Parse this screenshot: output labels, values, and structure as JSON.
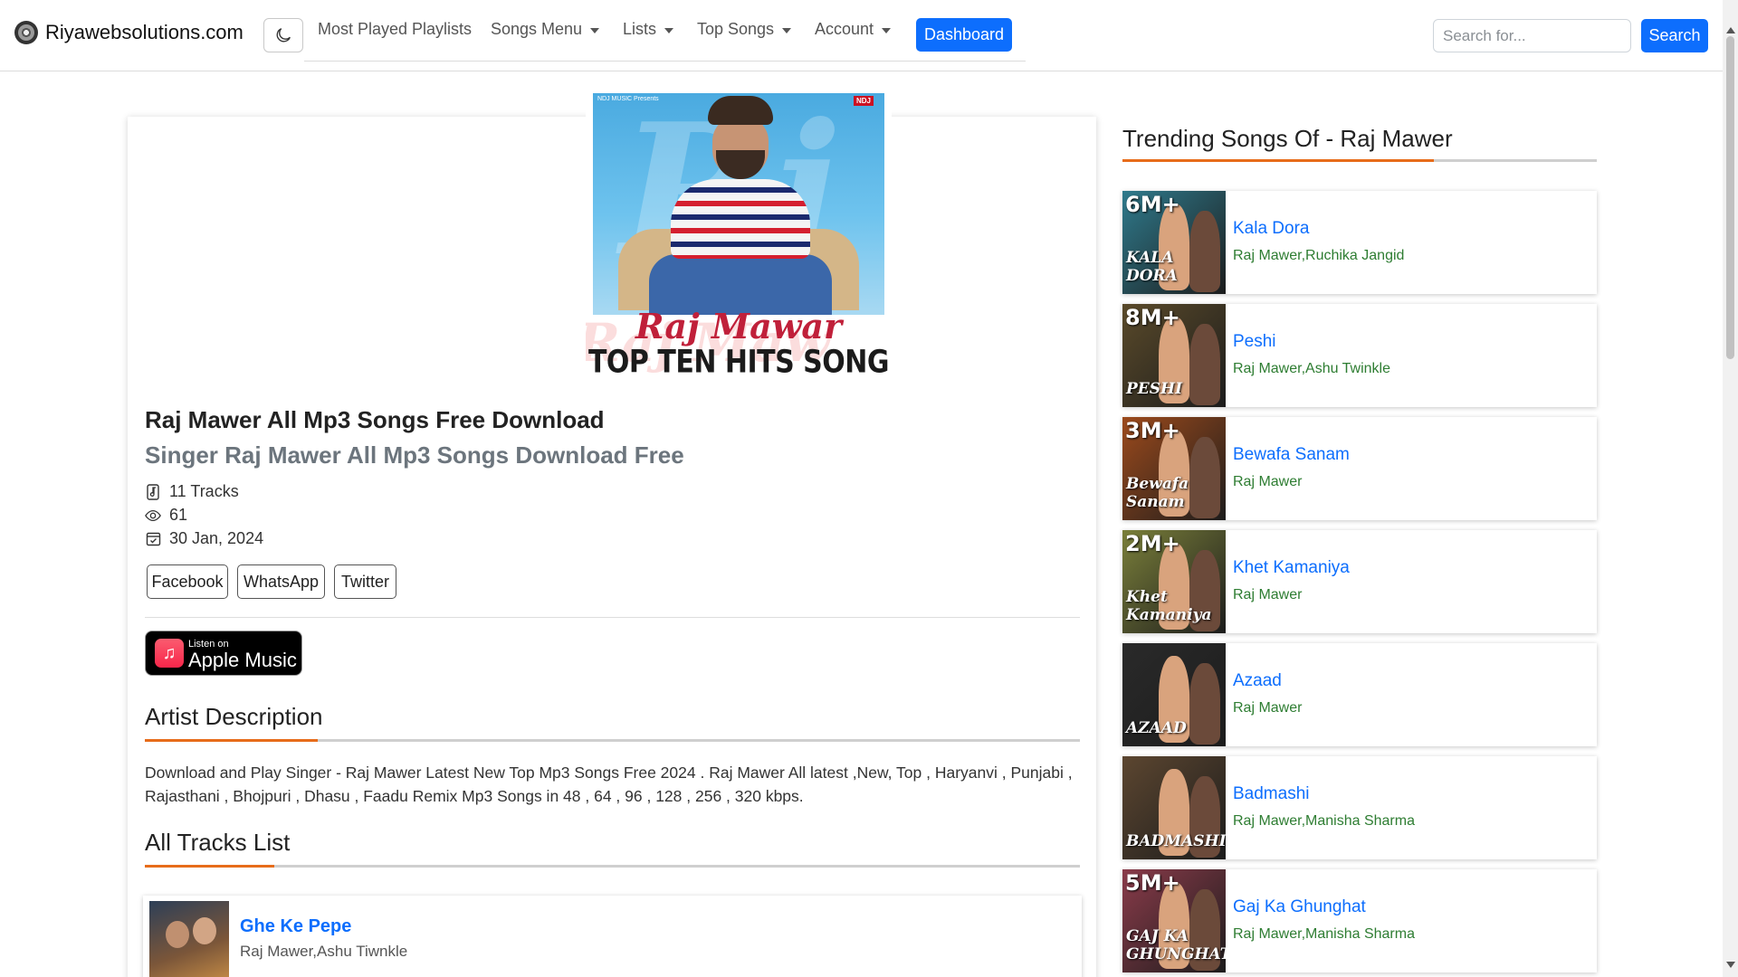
{
  "header": {
    "brand": "Riyawebsolutions.com",
    "nav": [
      "Most Played Playlists",
      "Songs Menu",
      "Lists",
      "Top Songs",
      "Account"
    ],
    "dashboard": "Dashboard",
    "search_placeholder": "Search for...",
    "search_button": "Search"
  },
  "cover": {
    "brand_text": "NDJ MUSIC Presents",
    "tag": "NDJ",
    "title1": "Raj Mawar",
    "title2": "TOP TEN HITS SONG"
  },
  "artist": {
    "title": "Raj Mawer All Mp3 Songs Free Download",
    "subtitle": "Singer Raj Mawer All Mp3 Songs Download Free",
    "tracks": "11 Tracks",
    "views": "61",
    "date": "30 Jan, 2024"
  },
  "share": [
    "Facebook",
    "WhatsApp",
    "Twitter"
  ],
  "apple": {
    "small": "Listen on",
    "big": "Apple Music"
  },
  "description": {
    "heading": "Artist Description",
    "text": "Download and Play Singer - Raj Mawer Latest New Top Mp3 Songs Free 2024 . Raj Mawer All latest ,New, Top , Haryanvi , Punjabi , Rajasthani , Bhojpuri , Dhasu , Faadu Remix Mp3 Songs in 48 , 64 , 96 , 128 , 256 , 320 kbps."
  },
  "tracks_list": {
    "heading": "All Tracks List",
    "items": [
      {
        "name": "Ghe Ke Pepe",
        "artist": "Raj Mawer,Ashu Tiwnkle"
      }
    ]
  },
  "trending": {
    "heading": "Trending Songs Of - Raj Mawer",
    "items": [
      {
        "name": "Kala Dora",
        "artist": "Raj Mawer,Ruchika Jangid",
        "views": "6M+",
        "thumb_title": "KALA DORA",
        "bg": "#2f7a8c"
      },
      {
        "name": "Peshi",
        "artist": "Raj Mawer,Ashu Twinkle",
        "views": "8M+",
        "thumb_title": "PESHI",
        "bg": "#5a4a2a"
      },
      {
        "name": "Bewafa Sanam",
        "artist": "Raj Mawer",
        "views": "3M+",
        "thumb_title": "Bewafa Sanam",
        "bg": "#9c4a1c"
      },
      {
        "name": "Khet Kamaniya",
        "artist": "Raj Mawer",
        "views": "2M+",
        "thumb_title": "Khet Kamaniya",
        "bg": "#7a7f3a"
      },
      {
        "name": "Azaad",
        "artist": "Raj Mawer",
        "views": "",
        "thumb_title": "AZAAD",
        "bg": "#2a2a2a"
      },
      {
        "name": "Badmashi",
        "artist": "Raj Mawer,Manisha Sharma",
        "views": "",
        "thumb_title": "BADMASHI",
        "bg": "#5c4630"
      },
      {
        "name": "Gaj Ka Ghunghat",
        "artist": "Raj Mawer,Manisha Sharma",
        "views": "5M+",
        "thumb_title": "GAJ KA GHUNGHAT",
        "bg": "#8a3b4a"
      }
    ]
  }
}
